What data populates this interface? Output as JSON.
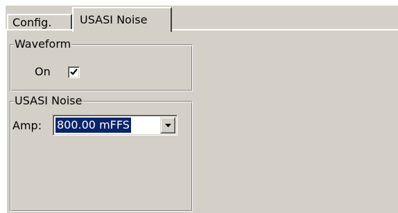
{
  "tabs": [
    {
      "label": "Config.",
      "selected": false
    },
    {
      "label": "USASI Noise",
      "selected": true
    }
  ],
  "waveform_group": {
    "title": "Waveform",
    "on_label": "On",
    "on_checked": true
  },
  "usasi_group": {
    "title": "USASI Noise",
    "amp_label": "Amp:",
    "amp_value": "800.00 mFFS"
  },
  "icons": {
    "checkbox_mark": "check-icon",
    "dropdown": "chevron-down-icon"
  },
  "colors": {
    "face": "#d4d0c8",
    "selection": "#0a246a"
  }
}
